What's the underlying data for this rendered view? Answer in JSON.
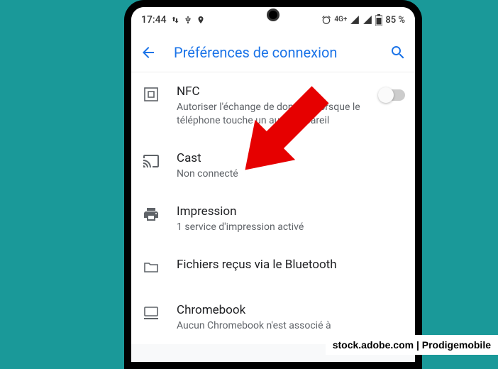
{
  "statusbar": {
    "time": "17:44",
    "network_label": "4G+",
    "battery_text": "85 %",
    "battery_icon_level": 85
  },
  "appbar": {
    "title": "Préférences de connexion"
  },
  "items": {
    "nfc": {
      "title": "NFC",
      "sub": "Autoriser l'échange de données lorsque le téléphone touche un autre appareil",
      "toggle_on": false
    },
    "cast": {
      "title": "Cast",
      "sub": "Non connecté"
    },
    "print": {
      "title": "Impression",
      "sub": "1 service d'impression activé"
    },
    "bt_files": {
      "title": "Fichiers reçus via le Bluetooth"
    },
    "chromebook": {
      "title": "Chromebook",
      "sub": "Aucun Chromebook n'est associé à"
    }
  },
  "credit": "stock.adobe.com | Prodigemobile"
}
